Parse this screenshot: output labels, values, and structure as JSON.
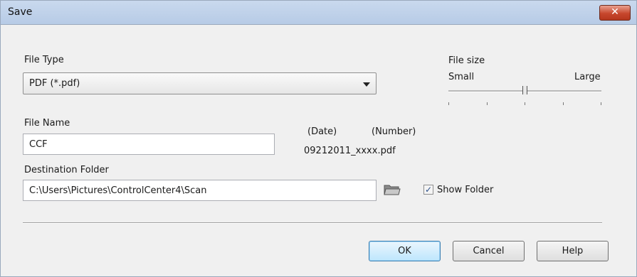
{
  "window": {
    "title": "Save",
    "close_label": "✕"
  },
  "file_type": {
    "label": "File Type",
    "selected": "PDF (*.pdf)"
  },
  "file_size": {
    "label": "File size",
    "min_label": "Small",
    "max_label": "Large",
    "level": 0.5
  },
  "file_name": {
    "label": "File Name",
    "value": "CCF",
    "preview_date_label": "(Date)",
    "preview_number_label": "(Number)",
    "preview_filename": "09212011_xxxx.pdf"
  },
  "destination": {
    "label": "Destination Folder",
    "value": "C:\\Users\\Pictures\\ControlCenter4\\Scan",
    "browse_icon": "folder-icon",
    "show_folder_label": "Show Folder",
    "show_folder_checked": true
  },
  "buttons": {
    "ok": "OK",
    "cancel": "Cancel",
    "help": "Help"
  }
}
